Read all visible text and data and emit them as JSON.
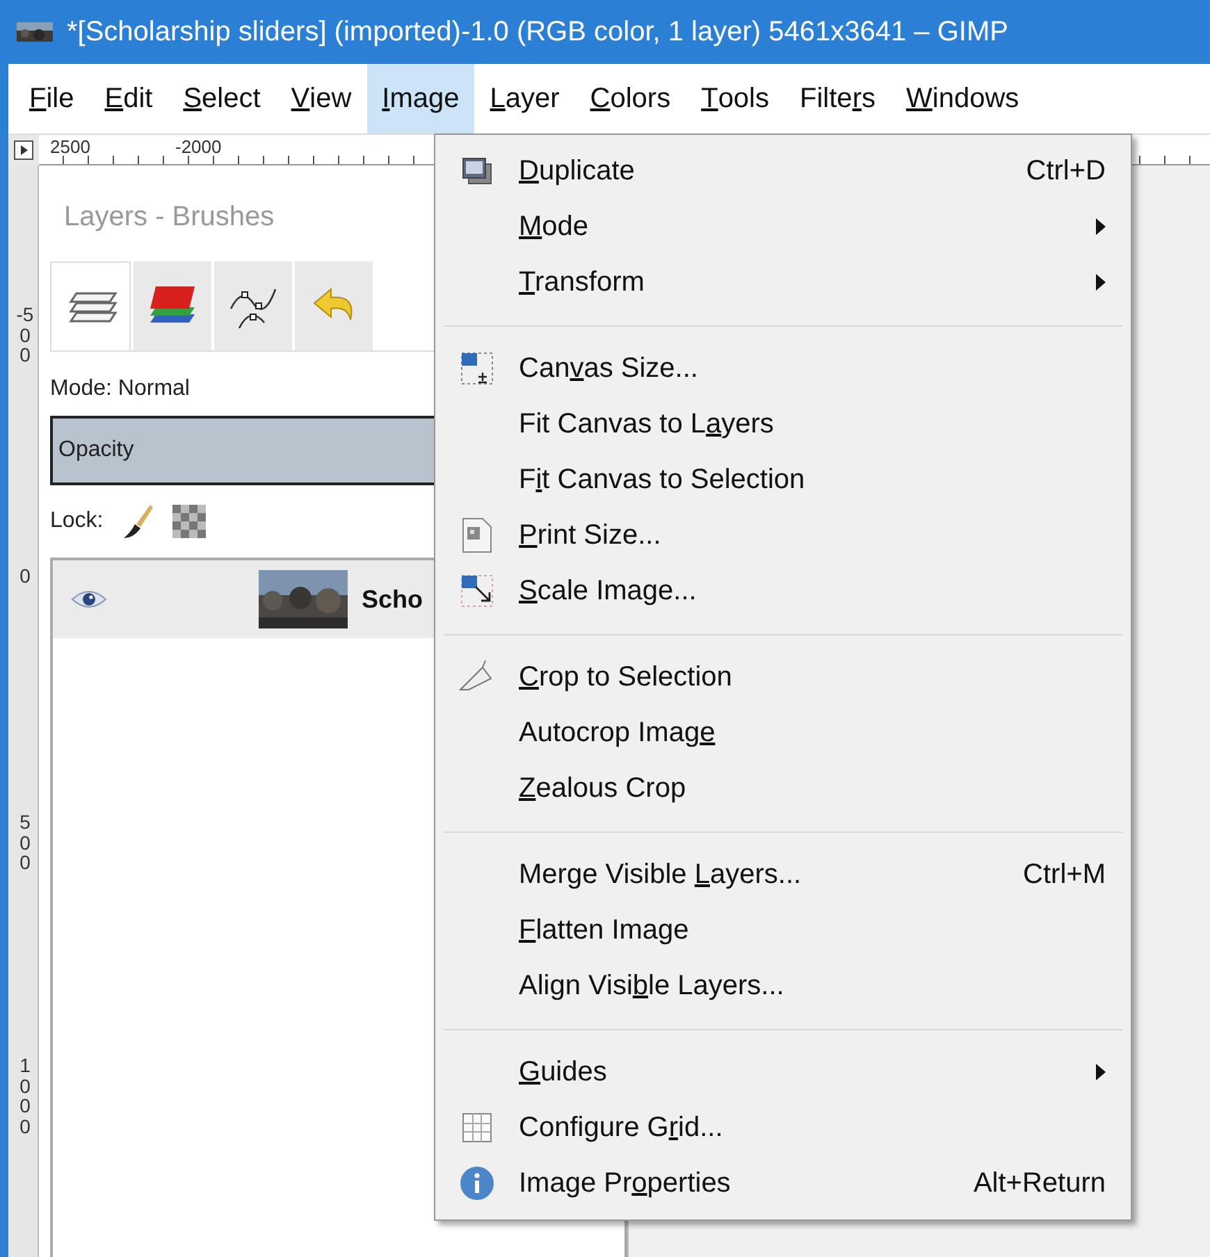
{
  "window": {
    "title": "*[Scholarship sliders] (imported)-1.0 (RGB color, 1 layer) 5461x3641 – GIMP"
  },
  "menubar": [
    {
      "key": "F",
      "post": "ile",
      "selected": false
    },
    {
      "key": "E",
      "post": "dit",
      "selected": false
    },
    {
      "key": "S",
      "post": "elect",
      "selected": false
    },
    {
      "key": "V",
      "post": "iew",
      "selected": false
    },
    {
      "key": "I",
      "post": "mage",
      "selected": true
    },
    {
      "key": "L",
      "post": "ayer",
      "selected": false
    },
    {
      "key": "C",
      "post": "olors",
      "selected": false
    },
    {
      "key": "T",
      "post": "ools",
      "selected": false
    },
    {
      "pre": "Filte",
      "key": "r",
      "post": "s",
      "selected": false
    },
    {
      "key": "W",
      "post": "indows",
      "selected": false
    }
  ],
  "top_ruler": [
    "2500",
    "-2000"
  ],
  "left_ruler": [
    "-500",
    "0",
    "500",
    "1000"
  ],
  "dock": {
    "title": "Layers - Brushes",
    "tabs": [
      {
        "selected": true
      },
      {
        "selected": false
      },
      {
        "selected": false
      },
      {
        "selected": false
      }
    ],
    "mode": "Mode: Normal",
    "opacity": {
      "label": "Opacity",
      "level": 1
    },
    "lock": "Lock:",
    "layers": [
      {
        "name": "Scho",
        "visible": true,
        "selected": true
      }
    ]
  },
  "menu": [
    {
      "kind": "item",
      "key": "D",
      "post": "uplicate",
      "shortcut": "Ctrl+D"
    },
    {
      "kind": "item",
      "key": "M",
      "post": "ode",
      "submenu": true
    },
    {
      "kind": "item",
      "key": "T",
      "post": "ransform",
      "submenu": true
    },
    {
      "kind": "separator"
    },
    {
      "kind": "item",
      "pre": "Can",
      "key": "v",
      "post": "as Size..."
    },
    {
      "kind": "item",
      "pre": "Fit Canvas to L",
      "key": "a",
      "post": "yers"
    },
    {
      "kind": "item",
      "pre": "F",
      "key": "i",
      "post": "t Canvas to Selection"
    },
    {
      "kind": "item",
      "key": "P",
      "post": "rint Size..."
    },
    {
      "kind": "item",
      "key": "S",
      "post": "cale Image..."
    },
    {
      "kind": "separator"
    },
    {
      "kind": "item",
      "key": "C",
      "post": "rop to Selection"
    },
    {
      "kind": "item",
      "pre": "Autocrop Imag",
      "key": "e"
    },
    {
      "kind": "item",
      "key": "Z",
      "post": "ealous Crop"
    },
    {
      "kind": "separator"
    },
    {
      "kind": "item",
      "pre": "Merge Visible ",
      "key": "L",
      "post": "ayers...",
      "shortcut": "Ctrl+M"
    },
    {
      "kind": "item",
      "key": "F",
      "post": "latten Image"
    },
    {
      "kind": "item",
      "pre": "Align Visi",
      "key": "b",
      "post": "le Layers..."
    },
    {
      "kind": "separator"
    },
    {
      "kind": "item",
      "key": "G",
      "post": "uides",
      "submenu": true
    },
    {
      "kind": "item",
      "pre": "Configure G",
      "key": "r",
      "post": "id..."
    },
    {
      "kind": "item",
      "pre": "Image Pr",
      "key": "o",
      "post": "perties",
      "shortcut": "Alt+Return"
    }
  ]
}
